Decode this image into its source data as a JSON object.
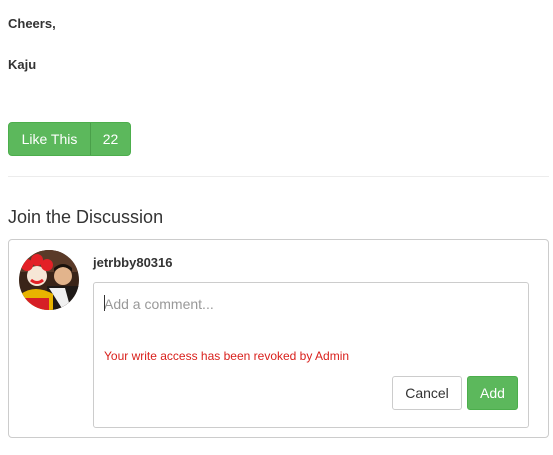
{
  "signoff": {
    "greeting": "Cheers,",
    "author": "Kaju"
  },
  "like": {
    "label": "Like This",
    "count": "22"
  },
  "discussion": {
    "title": "Join the Discussion",
    "username": "jetrbby80316",
    "comment_placeholder": "Add a comment...",
    "comment_value": "",
    "error_message": "Your write access has been revoked by Admin",
    "cancel_label": "Cancel",
    "add_label": "Add"
  },
  "colors": {
    "accent": "#5cb85c",
    "error": "#d9201c",
    "border": "#cccccc"
  }
}
